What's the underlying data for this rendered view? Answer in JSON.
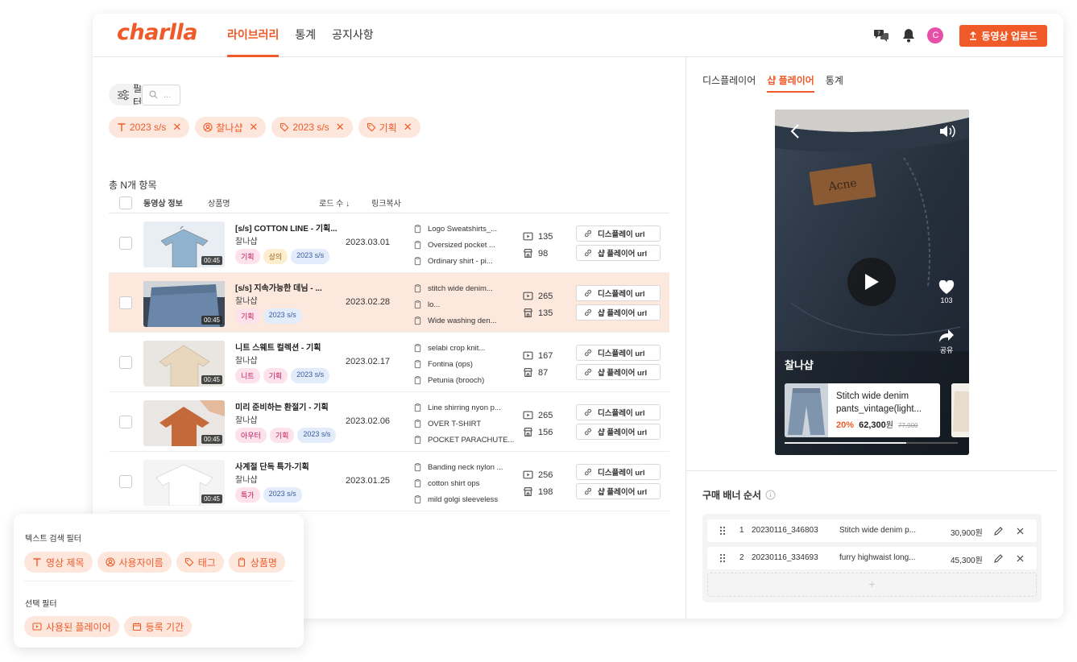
{
  "header": {
    "logo": "charlla",
    "nav": [
      {
        "label": "라이브러리",
        "active": true
      },
      {
        "label": "통계",
        "active": false
      },
      {
        "label": "공지사항",
        "active": false
      }
    ],
    "avatar_letter": "C",
    "upload_label": "동영상 업로드",
    "accent_color": "#f05a28"
  },
  "library": {
    "filter_label": "필터",
    "search_placeholder": "...",
    "chips": [
      {
        "icon": "text-icon",
        "label": "2023 s/s"
      },
      {
        "icon": "user-icon",
        "label": "찰나샵"
      },
      {
        "icon": "tag-icon",
        "label": "2023 s/s"
      },
      {
        "icon": "tag-icon",
        "label": "기획"
      }
    ],
    "total_label": "총 N개 항목",
    "columns": {
      "video_info": "동영상 정보",
      "product_name": "상품명",
      "load_count": "로드 수 ↓",
      "link_copy": "링크복사"
    },
    "display_url_label": "디스플레이 url",
    "shop_url_label": "샵 플레이어 url",
    "rows": [
      {
        "duration": "00:45",
        "title": "[s/s] COTTON LINE - 기획...",
        "user": "찰나샵",
        "tags": [
          "기획",
          "상의",
          "2023 s/s"
        ],
        "date": "2023.03.01",
        "products": [
          "Logo Sweatshirts_...",
          "Oversized pocket ...",
          "Ordinary shirt - pi..."
        ],
        "plays": "135",
        "shop_views": "98",
        "highlighted": false
      },
      {
        "duration": "00:45",
        "title": "[s/s] 지속가능한 데님 - ...",
        "user": "찰나샵",
        "tags": [
          "기획",
          "2023 s/s"
        ],
        "date": "2023.02.28",
        "products": [
          "stitch wide denim...",
          "lo...",
          "Wide washing den..."
        ],
        "plays": "265",
        "shop_views": "135",
        "highlighted": true
      },
      {
        "duration": "00:45",
        "title": "니트 스웨트 컬렉션 - 기획",
        "user": "찰나샵",
        "tags": [
          "니트",
          "기획",
          "2023 s/s"
        ],
        "date": "2023.02.17",
        "products": [
          "selabi crop knit...",
          "Fontina (ops)",
          "Petunia (brooch)"
        ],
        "plays": "167",
        "shop_views": "87",
        "highlighted": false
      },
      {
        "duration": "00:45",
        "title": "미리 준비하는 환절기 - 기획",
        "user": "찰나샵",
        "tags": [
          "아우터",
          "기획",
          "2023 s/s"
        ],
        "date": "2023.02.06",
        "products": [
          "Line shirring nyon p...",
          "OVER T-SHIRT",
          "POCKET PARACHUTE..."
        ],
        "plays": "265",
        "shop_views": "156",
        "highlighted": false
      },
      {
        "duration": "00:45",
        "title": "사계절 단독 특가-기획",
        "user": "찰나샵",
        "tags": [
          "특가",
          "2023 s/s"
        ],
        "date": "2023.01.25",
        "products": [
          "Banding neck nylon ...",
          "cotton shirt ops",
          "mild golgi sleeveless"
        ],
        "plays": "256",
        "shop_views": "198",
        "highlighted": false
      }
    ]
  },
  "preview": {
    "tabs": [
      {
        "label": "디스플레이어",
        "active": false
      },
      {
        "label": "샵 플레이어",
        "active": true
      },
      {
        "label": "통계",
        "active": false
      }
    ],
    "patch_text": "Acne",
    "likes": "103",
    "share_label": "공유",
    "store_name": "찰나샵",
    "product": {
      "name": "Stitch wide denim pants_vintage(light...",
      "discount": "20%",
      "price": "62,300",
      "unit": "원",
      "original": "77,900"
    },
    "progress": 0.7
  },
  "banners": {
    "title": "구매 배너 순서",
    "add_label": "+",
    "items": [
      {
        "order": "1",
        "code": "20230116_346803",
        "name": "Stitch wide denim p...",
        "price": "30,900원"
      },
      {
        "order": "2",
        "code": "20230116_334693",
        "name": "furry highwaist long...",
        "price": "45,300원"
      }
    ]
  },
  "filter_panel": {
    "text_section": "텍스트 검색 필터",
    "text_chips": [
      {
        "icon": "text-icon",
        "label": "영상 제목"
      },
      {
        "icon": "user-icon",
        "label": "사용자이름"
      },
      {
        "icon": "tag-icon",
        "label": "태그"
      },
      {
        "icon": "clipboard-icon",
        "label": "상품명"
      }
    ],
    "select_section": "선택 필터",
    "select_chips": [
      {
        "icon": "player-icon",
        "label": "사용된 플레이어"
      },
      {
        "icon": "calendar-icon",
        "label": "등록 기간"
      }
    ]
  }
}
